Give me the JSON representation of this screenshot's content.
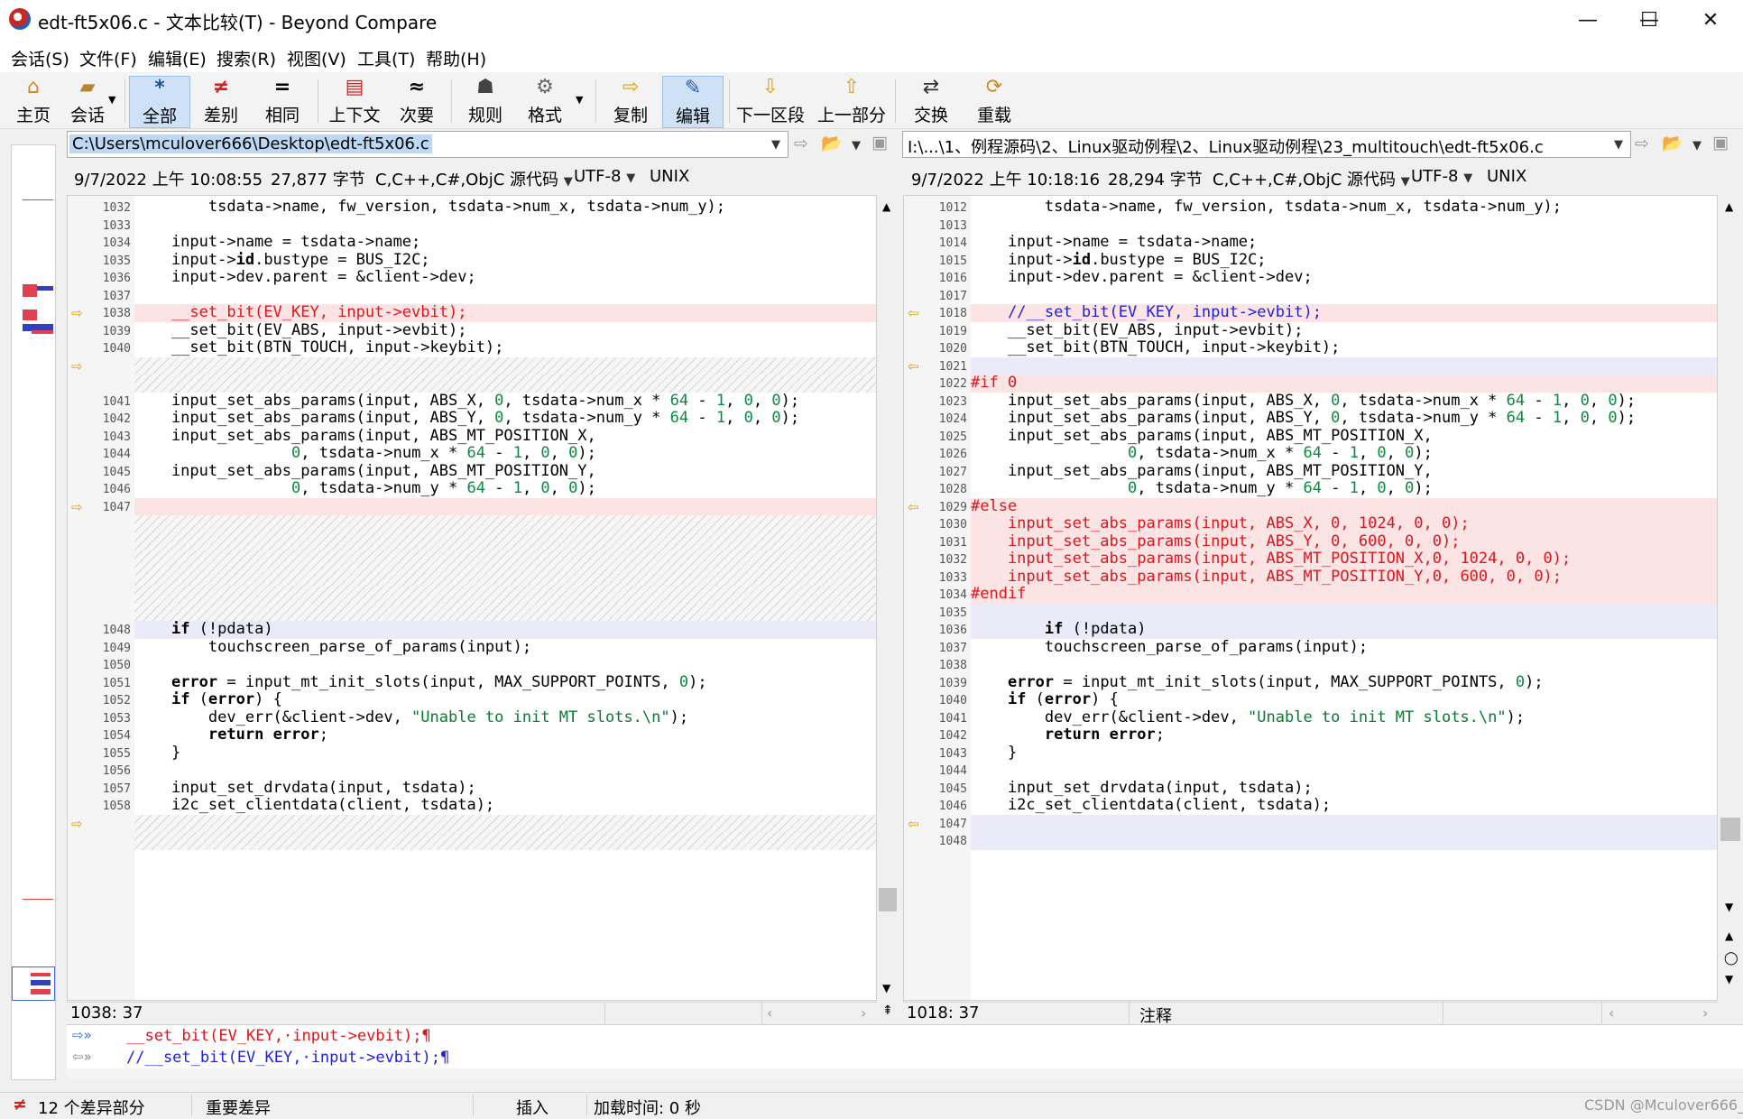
{
  "window": {
    "title": "edt-ft5x06.c - 文本比较(T) - Beyond Compare",
    "minimize": "—",
    "maximize": "☐",
    "close": "✕"
  },
  "menu": [
    "会话(S)",
    "文件(F)",
    "编辑(E)",
    "搜索(R)",
    "视图(V)",
    "工具(T)",
    "帮助(H)"
  ],
  "toolbar": {
    "home": "主页",
    "session": "会话",
    "all": "全部",
    "diffs": "差别",
    "same": "相同",
    "context": "上下文",
    "minor": "次要",
    "rules": "规则",
    "format": "格式",
    "copy": "复制",
    "edit": "编辑",
    "next_section": "下一区段",
    "prev_section": "上一部分",
    "swap": "交换",
    "reload": "重载"
  },
  "left": {
    "path": "C:\\Users\\mculover666\\Desktop\\edt-ft5x06.c",
    "date": "9/7/2022 上午 10:08:55",
    "size": "27,877 字节",
    "format": "C,C++,C#,ObjC 源代码",
    "encoding": "UTF-8",
    "eol": "UNIX",
    "cursor": "1038: 37",
    "lines": [
      {
        "n": "1032",
        "c": "        tsdata->name, fw_version, tsdata->num_x, tsdata->num_y);"
      },
      {
        "n": "1033",
        "c": ""
      },
      {
        "n": "1034",
        "c": "    input->name = tsdata->name;"
      },
      {
        "n": "1035",
        "c": "    input->id.bustype = BUS_I2C;"
      },
      {
        "n": "1036",
        "c": "    input->dev.parent = &client->dev;"
      },
      {
        "n": "1037",
        "c": ""
      },
      {
        "n": "1038",
        "c": "    __set_bit(EV_KEY, input->evbit);",
        "t": "diff",
        "a": true
      },
      {
        "n": "1039",
        "c": "    __set_bit(EV_ABS, input->evbit);"
      },
      {
        "n": "1040",
        "c": "    __set_bit(BTN_TOUCH, input->keybit);"
      },
      {
        "n": "",
        "c": "",
        "t": "hatch",
        "a": true
      },
      {
        "n": "",
        "c": "",
        "t": "hatch"
      },
      {
        "n": "1041",
        "c": "    input_set_abs_params(input, ABS_X, 0, tsdata->num_x * 64 - 1, 0, 0);"
      },
      {
        "n": "1042",
        "c": "    input_set_abs_params(input, ABS_Y, 0, tsdata->num_y * 64 - 1, 0, 0);"
      },
      {
        "n": "1043",
        "c": "    input_set_abs_params(input, ABS_MT_POSITION_X,"
      },
      {
        "n": "1044",
        "c": "                 0, tsdata->num_x * 64 - 1, 0, 0);"
      },
      {
        "n": "1045",
        "c": "    input_set_abs_params(input, ABS_MT_POSITION_Y,"
      },
      {
        "n": "1046",
        "c": "                 0, tsdata->num_y * 64 - 1, 0, 0);"
      },
      {
        "n": "1047",
        "c": "",
        "t": "diff",
        "a": true
      },
      {
        "n": "",
        "c": "",
        "t": "hatch"
      },
      {
        "n": "",
        "c": "",
        "t": "hatch"
      },
      {
        "n": "",
        "c": "",
        "t": "hatch"
      },
      {
        "n": "",
        "c": "",
        "t": "hatch"
      },
      {
        "n": "",
        "c": "",
        "t": "hatch"
      },
      {
        "n": "",
        "c": "",
        "t": "hatch"
      },
      {
        "n": "1048",
        "c": "    if (!pdata)",
        "t": "minor"
      },
      {
        "n": "1049",
        "c": "        touchscreen_parse_of_params(input);"
      },
      {
        "n": "1050",
        "c": ""
      },
      {
        "n": "1051",
        "c": "    error = input_mt_init_slots(input, MAX_SUPPORT_POINTS, 0);"
      },
      {
        "n": "1052",
        "c": "    if (error) {"
      },
      {
        "n": "1053",
        "c": "        dev_err(&client->dev, \"Unable to init MT slots.\\n\");"
      },
      {
        "n": "1054",
        "c": "        return error;"
      },
      {
        "n": "1055",
        "c": "    }"
      },
      {
        "n": "1056",
        "c": ""
      },
      {
        "n": "1057",
        "c": "    input_set_drvdata(input, tsdata);"
      },
      {
        "n": "1058",
        "c": "    i2c_set_clientdata(client, tsdata);"
      },
      {
        "n": "",
        "c": "",
        "t": "hatch",
        "a": true
      },
      {
        "n": "",
        "c": "",
        "t": "hatch"
      }
    ]
  },
  "right": {
    "path": "I:\\...\\1、例程源码\\2、Linux驱动例程\\2、Linux驱动例程\\23_multitouch\\edt-ft5x06.c",
    "date": "9/7/2022 上午 10:18:16",
    "size": "28,294 字节",
    "format": "C,C++,C#,ObjC 源代码",
    "encoding": "UTF-8",
    "eol": "UNIX",
    "cursor": "1018: 37",
    "status_label": "注释",
    "lines": [
      {
        "n": "1012",
        "c": "        tsdata->name, fw_version, tsdata->num_x, tsdata->num_y);"
      },
      {
        "n": "1013",
        "c": ""
      },
      {
        "n": "1014",
        "c": "    input->name = tsdata->name;"
      },
      {
        "n": "1015",
        "c": "    input->id.bustype = BUS_I2C;"
      },
      {
        "n": "1016",
        "c": "    input->dev.parent = &client->dev;"
      },
      {
        "n": "1017",
        "c": ""
      },
      {
        "n": "1018",
        "c": "    //__set_bit(EV_KEY, input->evbit);",
        "t": "diff",
        "a": true
      },
      {
        "n": "1019",
        "c": "    __set_bit(EV_ABS, input->evbit);"
      },
      {
        "n": "1020",
        "c": "    __set_bit(BTN_TOUCH, input->keybit);"
      },
      {
        "n": "1021",
        "c": "",
        "t": "minor",
        "a": true
      },
      {
        "n": "1022",
        "c": "#if 0",
        "t": "diff"
      },
      {
        "n": "1023",
        "c": "    input_set_abs_params(input, ABS_X, 0, tsdata->num_x * 64 - 1, 0, 0);"
      },
      {
        "n": "1024",
        "c": "    input_set_abs_params(input, ABS_Y, 0, tsdata->num_y * 64 - 1, 0, 0);"
      },
      {
        "n": "1025",
        "c": "    input_set_abs_params(input, ABS_MT_POSITION_X,"
      },
      {
        "n": "1026",
        "c": "                 0, tsdata->num_x * 64 - 1, 0, 0);"
      },
      {
        "n": "1027",
        "c": "    input_set_abs_params(input, ABS_MT_POSITION_Y,"
      },
      {
        "n": "1028",
        "c": "                 0, tsdata->num_y * 64 - 1, 0, 0);"
      },
      {
        "n": "1029",
        "c": "#else",
        "t": "diff",
        "a": true
      },
      {
        "n": "1030",
        "c": "    input_set_abs_params(input, ABS_X, 0, 1024, 0, 0);",
        "t": "diff"
      },
      {
        "n": "1031",
        "c": "    input_set_abs_params(input, ABS_Y, 0, 600, 0, 0);",
        "t": "diff"
      },
      {
        "n": "1032",
        "c": "    input_set_abs_params(input, ABS_MT_POSITION_X,0, 1024, 0, 0);",
        "t": "diff"
      },
      {
        "n": "1033",
        "c": "    input_set_abs_params(input, ABS_MT_POSITION_Y,0, 600, 0, 0);",
        "t": "diff"
      },
      {
        "n": "1034",
        "c": "#endif",
        "t": "diff"
      },
      {
        "n": "1035",
        "c": "",
        "t": "minor"
      },
      {
        "n": "1036",
        "c": "        if (!pdata)",
        "t": "minor"
      },
      {
        "n": "1037",
        "c": "        touchscreen_parse_of_params(input);"
      },
      {
        "n": "1038",
        "c": ""
      },
      {
        "n": "1039",
        "c": "    error = input_mt_init_slots(input, MAX_SUPPORT_POINTS, 0);"
      },
      {
        "n": "1040",
        "c": "    if (error) {"
      },
      {
        "n": "1041",
        "c": "        dev_err(&client->dev, \"Unable to init MT slots.\\n\");"
      },
      {
        "n": "1042",
        "c": "        return error;"
      },
      {
        "n": "1043",
        "c": "    }"
      },
      {
        "n": "1044",
        "c": ""
      },
      {
        "n": "1045",
        "c": "    input_set_drvdata(input, tsdata);"
      },
      {
        "n": "1046",
        "c": "    i2c_set_clientdata(client, tsdata);"
      },
      {
        "n": "1047",
        "c": "",
        "t": "minor",
        "a": true
      },
      {
        "n": "1048",
        "c": "",
        "t": "minor"
      }
    ]
  },
  "compare": {
    "left_line": "__set_bit(EV_KEY,·input->evbit);¶",
    "right_line": "//__set_bit(EV_KEY,·input->evbit);¶"
  },
  "status": {
    "diff_count": "12 个差异部分",
    "important": "重要差异",
    "insert": "插入",
    "load_time": "加载时间:  0 秒",
    "watermark": "CSDN @Mculover666_"
  },
  "colors": {
    "diff_bg": "#fde4e4",
    "diff_text": "#e0141a",
    "minor_bg": "#eaeaf8",
    "comment_text": "#2020e0",
    "active_btn": "#cfe1f7"
  }
}
